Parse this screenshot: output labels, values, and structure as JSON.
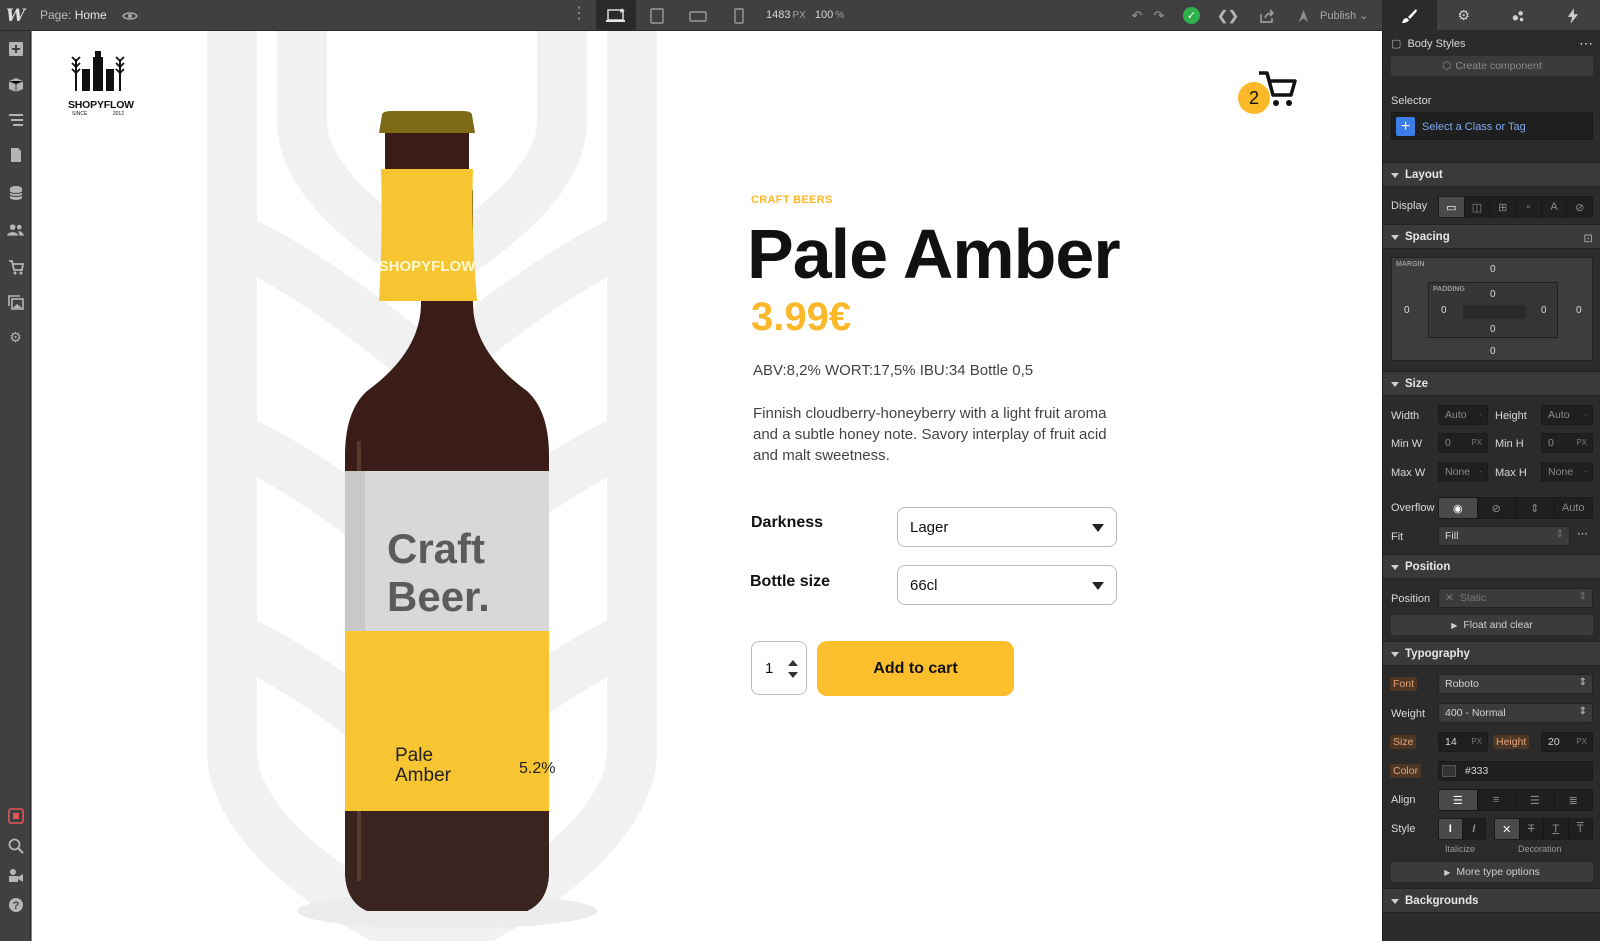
{
  "topbar": {
    "page_label": "Page:",
    "page_name": "Home",
    "width_value": "1483",
    "width_unit": "PX",
    "zoom_value": "100",
    "zoom_unit": "%",
    "publish_label": "Publish"
  },
  "panel_tabs": [
    "style-brush-icon",
    "gear-icon",
    "interactions-drops-icon",
    "lightning-icon"
  ],
  "canvas": {
    "brand_name": "SHOPYFLOW",
    "brand_since_left": "SINCE",
    "brand_since_right": "2012",
    "cart_count": "2",
    "category": "CRAFT BEERS",
    "title": "Pale Amber",
    "price": "3.99€",
    "specs": "ABV:8,2% WORT:17,5% IBU:34 Bottle 0,5",
    "description": "Finnish cloudberry-honeyberry with a light fruit aroma and a subtle honey note. Savory interplay of fruit acid and malt sweetness.",
    "options": [
      {
        "label": "Darkness",
        "value": "Lager"
      },
      {
        "label": "Bottle size",
        "value": "66cl"
      }
    ],
    "quantity": "1",
    "add_to_cart": "Add to cart",
    "bottle_label": {
      "brand": "SHOPYFLOW",
      "headline_1": "Craft",
      "headline_2": "Beer.",
      "name_1": "Pale",
      "name_2": "Amber",
      "abv": "5.2%"
    }
  },
  "panel": {
    "body_styles": "Body Styles",
    "create_component": "Create component",
    "selector_label": "Selector",
    "selector_placeholder": "Select a Class or Tag",
    "layout": {
      "title": "Layout",
      "display_label": "Display"
    },
    "spacing": {
      "title": "Spacing",
      "margin_label": "MARGIN",
      "padding_label": "PADDING",
      "margin_top": "0",
      "margin_right": "0",
      "margin_bottom": "0",
      "margin_left": "0",
      "padding_top": "0",
      "padding_right": "0",
      "padding_bottom": "0",
      "padding_left": "0"
    },
    "size": {
      "title": "Size",
      "width_label": "Width",
      "width_value": "Auto",
      "height_label": "Height",
      "height_value": "Auto",
      "minw_label": "Min W",
      "minw_value": "0",
      "minh_label": "Min H",
      "minh_value": "0",
      "maxw_label": "Max W",
      "maxw_value": "None",
      "maxh_label": "Max H",
      "maxh_value": "None",
      "unit_px": "PX",
      "unit_dash": "-",
      "overflow_label": "Overflow",
      "overflow_auto": "Auto",
      "fit_label": "Fit",
      "fit_value": "Fill"
    },
    "position": {
      "title": "Position",
      "position_label": "Position",
      "position_value": "Static",
      "float_clear": "Float and clear"
    },
    "typography": {
      "title": "Typography",
      "font_label": "Font",
      "font_value": "Roboto",
      "weight_label": "Weight",
      "weight_value": "400 - Normal",
      "size_label": "Size",
      "size_value": "14",
      "height_label": "Height",
      "height_value": "20",
      "unit_px": "PX",
      "color_label": "Color",
      "color_value": "#333",
      "align_label": "Align",
      "style_label": "Style",
      "italicize": "Italicize",
      "decoration": "Decoration",
      "more_options": "More type options"
    },
    "backgrounds": {
      "title": "Backgrounds"
    }
  },
  "colors": {
    "accent_yellow": "#fbb829",
    "designer_dark": "#2b2b2b",
    "designer_bar": "#404040",
    "selection_blue": "#4c8df6",
    "success_green": "#2fb24c"
  }
}
